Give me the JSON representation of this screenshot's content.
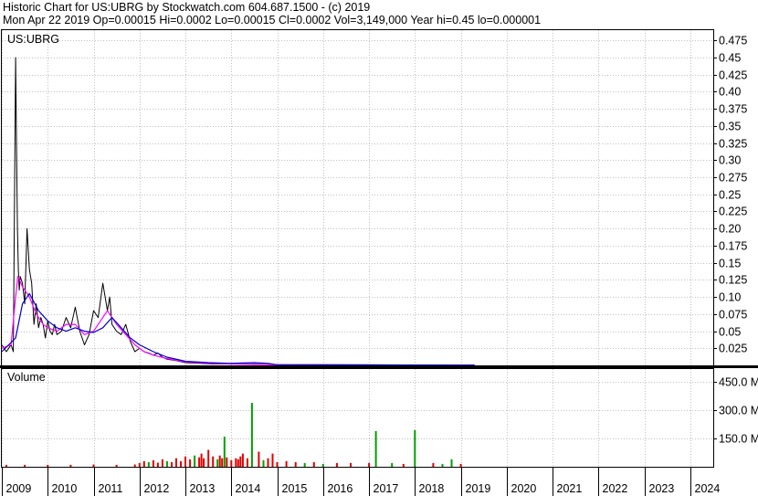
{
  "header": {
    "line1": "Historic Chart for US:UBRG by Stockwatch.com 604.687.1500 - (c) 2019",
    "line2": "Mon Apr 22 2019   Op=0.00015   Hi=0.0002   Lo=0.00015   Cl=0.0002   Vol=3,149,000   Year hi=0.45   lo=0.000001"
  },
  "chart_data": {
    "type": "line",
    "symbol_label": "US:UBRG",
    "volume_label": "Volume",
    "price_axis": {
      "ylim": [
        0,
        0.49
      ],
      "ticks": [
        "0.025",
        "0.05",
        "0.075",
        "0.10",
        "0.125",
        "0.15",
        "0.175",
        "0.20",
        "0.225",
        "0.25",
        "0.275",
        "0.30",
        "0.325",
        "0.35",
        "0.375",
        "0.40",
        "0.425",
        "0.45",
        "0.475"
      ],
      "tick_values": [
        0.025,
        0.05,
        0.075,
        0.1,
        0.125,
        0.15,
        0.175,
        0.2,
        0.225,
        0.25,
        0.275,
        0.3,
        0.325,
        0.35,
        0.375,
        0.4,
        0.425,
        0.45,
        0.475
      ]
    },
    "volume_axis": {
      "ylim": [
        0,
        520
      ],
      "ticks": [
        "150.0 M",
        "300.0 M",
        "450.0 M"
      ],
      "tick_values": [
        150,
        300,
        450
      ]
    },
    "x_axis": {
      "xlim": [
        2009.0,
        2024.5
      ],
      "ticks": [
        "2009",
        "2010",
        "2011",
        "2012",
        "2013",
        "2014",
        "2015",
        "2016",
        "2017",
        "2018",
        "2019",
        "2020",
        "2021",
        "2022",
        "2023",
        "2024"
      ],
      "tick_values": [
        2009,
        2010,
        2011,
        2012,
        2013,
        2014,
        2015,
        2016,
        2017,
        2018,
        2019,
        2020,
        2021,
        2022,
        2023,
        2024
      ]
    },
    "colors": {
      "price": "#000000",
      "ma_short": "#ff00ff",
      "ma_long": "#0000cc",
      "vol_up": "#00a000",
      "vol_down": "#e00000",
      "grid": "#c0c0c0"
    },
    "series": [
      {
        "x": [
          2009.0,
          2009.05,
          2009.1,
          2009.15,
          2009.2,
          2009.25,
          2009.3,
          2009.32,
          2009.34,
          2009.36,
          2009.38,
          2009.4,
          2009.45,
          2009.5,
          2009.55,
          2009.6,
          2009.65,
          2009.7,
          2009.75,
          2009.8,
          2009.85,
          2009.9,
          2009.95,
          2010.0,
          2010.05,
          2010.1,
          2010.15,
          2010.2,
          2010.3,
          2010.4,
          2010.5,
          2010.6,
          2010.7,
          2010.8,
          2010.9,
          2011.0,
          2011.1,
          2011.2,
          2011.3,
          2011.35,
          2011.4,
          2011.5,
          2011.6,
          2011.7,
          2011.8,
          2011.9,
          2012.0,
          2012.1,
          2012.2,
          2012.3,
          2012.4,
          2012.5,
          2012.6,
          2012.8,
          2013.0,
          2013.3,
          2013.6,
          2014.0,
          2014.5,
          2015.0,
          2016.0,
          2017.0,
          2018.0,
          2019.0,
          2019.3
        ],
        "values": [
          0.03,
          0.025,
          0.02,
          0.025,
          0.03,
          0.02,
          0.45,
          0.32,
          0.2,
          0.14,
          0.11,
          0.13,
          0.12,
          0.09,
          0.2,
          0.14,
          0.12,
          0.06,
          0.09,
          0.055,
          0.07,
          0.06,
          0.04,
          0.065,
          0.05,
          0.045,
          0.06,
          0.045,
          0.05,
          0.07,
          0.055,
          0.085,
          0.05,
          0.03,
          0.045,
          0.08,
          0.07,
          0.12,
          0.08,
          0.1,
          0.06,
          0.05,
          0.045,
          0.06,
          0.035,
          0.02,
          0.025,
          0.02,
          0.018,
          0.015,
          0.018,
          0.012,
          0.009,
          0.007,
          0.004,
          0.003,
          0.002,
          0.002,
          0.002,
          0.001,
          0.001,
          0.0008,
          0.0005,
          0.0002,
          0.0002
        ]
      },
      {
        "x": [
          2009.0,
          2009.2,
          2009.3,
          2009.35,
          2009.45,
          2009.6,
          2009.75,
          2009.9,
          2010.0,
          2010.2,
          2010.4,
          2010.6,
          2010.8,
          2011.0,
          2011.2,
          2011.3,
          2011.5,
          2011.7,
          2011.9,
          2012.1,
          2012.3,
          2012.6,
          2013.0,
          2013.5,
          2014.0,
          2015.0,
          2019.3
        ],
        "values": [
          0.025,
          0.03,
          0.1,
          0.13,
          0.115,
          0.1,
          0.075,
          0.06,
          0.055,
          0.05,
          0.06,
          0.06,
          0.045,
          0.05,
          0.07,
          0.08,
          0.06,
          0.045,
          0.03,
          0.02,
          0.015,
          0.01,
          0.005,
          0.003,
          0.002,
          0.001,
          0.0003
        ]
      },
      {
        "x": [
          2009.0,
          2009.3,
          2009.45,
          2009.6,
          2009.8,
          2010.0,
          2010.2,
          2010.4,
          2010.6,
          2010.8,
          2011.0,
          2011.2,
          2011.4,
          2011.6,
          2011.8,
          2012.0,
          2012.3,
          2012.6,
          2013.0,
          2013.5,
          2014.0,
          2014.5,
          2014.8,
          2015.0,
          2019.3
        ],
        "values": [
          0.02,
          0.04,
          0.09,
          0.105,
          0.08,
          0.065,
          0.055,
          0.05,
          0.055,
          0.05,
          0.048,
          0.055,
          0.07,
          0.055,
          0.04,
          0.03,
          0.02,
          0.012,
          0.006,
          0.004,
          0.003,
          0.004,
          0.003,
          0.001,
          0.0004
        ]
      }
    ],
    "volume": {
      "x": [
        2009.1,
        2009.5,
        2010.0,
        2010.5,
        2011.0,
        2011.5,
        2011.9,
        2012.0,
        2012.1,
        2012.2,
        2012.3,
        2012.4,
        2012.5,
        2012.6,
        2012.7,
        2012.8,
        2012.9,
        2013.0,
        2013.1,
        2013.2,
        2013.3,
        2013.35,
        2013.4,
        2013.5,
        2013.6,
        2013.7,
        2013.75,
        2013.8,
        2013.85,
        2013.9,
        2014.0,
        2014.1,
        2014.15,
        2014.2,
        2014.25,
        2014.35,
        2014.45,
        2014.6,
        2014.7,
        2014.8,
        2014.9,
        2015.0,
        2015.2,
        2015.4,
        2015.6,
        2015.8,
        2016.0,
        2016.3,
        2016.6,
        2017.0,
        2017.15,
        2017.5,
        2017.75,
        2018.0,
        2018.4,
        2018.6,
        2018.8,
        2019.0
      ],
      "values": [
        10,
        10,
        10,
        10,
        12,
        10,
        12,
        20,
        30,
        25,
        35,
        22,
        40,
        30,
        25,
        45,
        30,
        55,
        40,
        60,
        50,
        70,
        45,
        90,
        55,
        40,
        60,
        45,
        160,
        50,
        35,
        45,
        40,
        55,
        70,
        45,
        340,
        80,
        35,
        45,
        70,
        25,
        30,
        25,
        20,
        25,
        15,
        20,
        20,
        20,
        190,
        20,
        15,
        195,
        20,
        15,
        40,
        15
      ],
      "direction": [
        "down",
        "down",
        "down",
        "down",
        "down",
        "down",
        "down",
        "down",
        "down",
        "up",
        "down",
        "down",
        "down",
        "up",
        "down",
        "down",
        "down",
        "down",
        "down",
        "up",
        "down",
        "down",
        "down",
        "down",
        "down",
        "up",
        "down",
        "down",
        "up",
        "down",
        "down",
        "down",
        "down",
        "down",
        "down",
        "down",
        "up",
        "down",
        "up",
        "down",
        "down",
        "down",
        "down",
        "down",
        "up",
        "down",
        "up",
        "down",
        "down",
        "down",
        "up",
        "up",
        "down",
        "up",
        "down",
        "up",
        "up",
        "down"
      ]
    }
  }
}
